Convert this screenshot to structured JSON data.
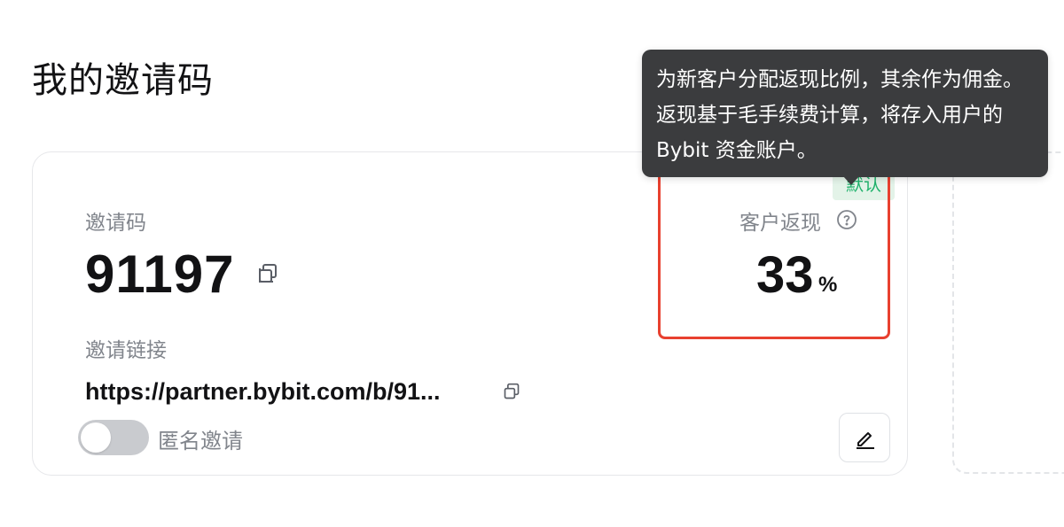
{
  "page": {
    "title": "我的邀请码"
  },
  "invite_card": {
    "code_label": "邀请码",
    "code_value": "91197",
    "link_label": "邀请链接",
    "link_value": "https://partner.bybit.com/b/91...",
    "anonymous_toggle": {
      "label": "匿名邀请",
      "state": "off"
    },
    "default_badge": "默认",
    "rebate_label": "客户返现",
    "rebate_value": "33",
    "rebate_unit": "%"
  },
  "tooltip": {
    "text": "为新客户分配返现比例，其余作为佣金。返现基于毛手续费计算，将存入用户的 Bybit 资金账户。"
  },
  "icons": {
    "copy": "copy-icon",
    "help": "question-circle-icon",
    "edit": "pencil-icon"
  },
  "colors": {
    "badge_green": "#20b26c",
    "badge_bg": "#e3f3e8",
    "highlight_red": "#e8402f",
    "tooltip_bg": "#3b3c3e",
    "muted_text": "#81858c"
  }
}
